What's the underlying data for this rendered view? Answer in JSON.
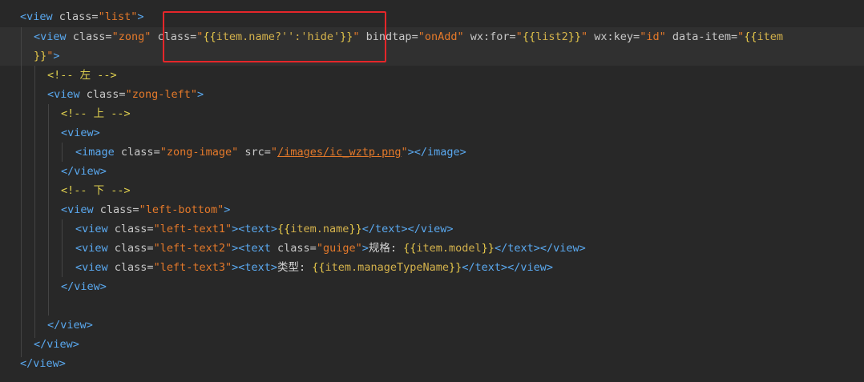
{
  "editor": {
    "lines": [
      "<view class=\"list\">",
      "<view class=\"zong\" class=\"{{item.name?'':'hide'}}\" bindtap=\"onAdd\" wx:for=\"{{list2}}\" wx:key=\"id\" data-item=\"{{item",
      "}}\">",
      "<!-- 左 -->",
      "<view class=\"zong-left\">",
      "<!-- 上 -->",
      "<view>",
      "<image class=\"zong-image\" src=\"/images/ic_wztp.png\"></image>",
      "</view>",
      "<!-- 下 -->",
      "<view class=\"left-bottom\">",
      "<view class=\"left-text1\"><text>{{item.name}}</text></view>",
      "<view class=\"left-text2\"><text class=\"guige\">规格: {{item.model}}</text></view>",
      "<view class=\"left-text3\"><text>类型: {{item.manageTypeName}}</text></view>",
      "</view>",
      "",
      "</view>",
      "</view>",
      "</view>"
    ]
  },
  "highlight_color": "#e5262a"
}
